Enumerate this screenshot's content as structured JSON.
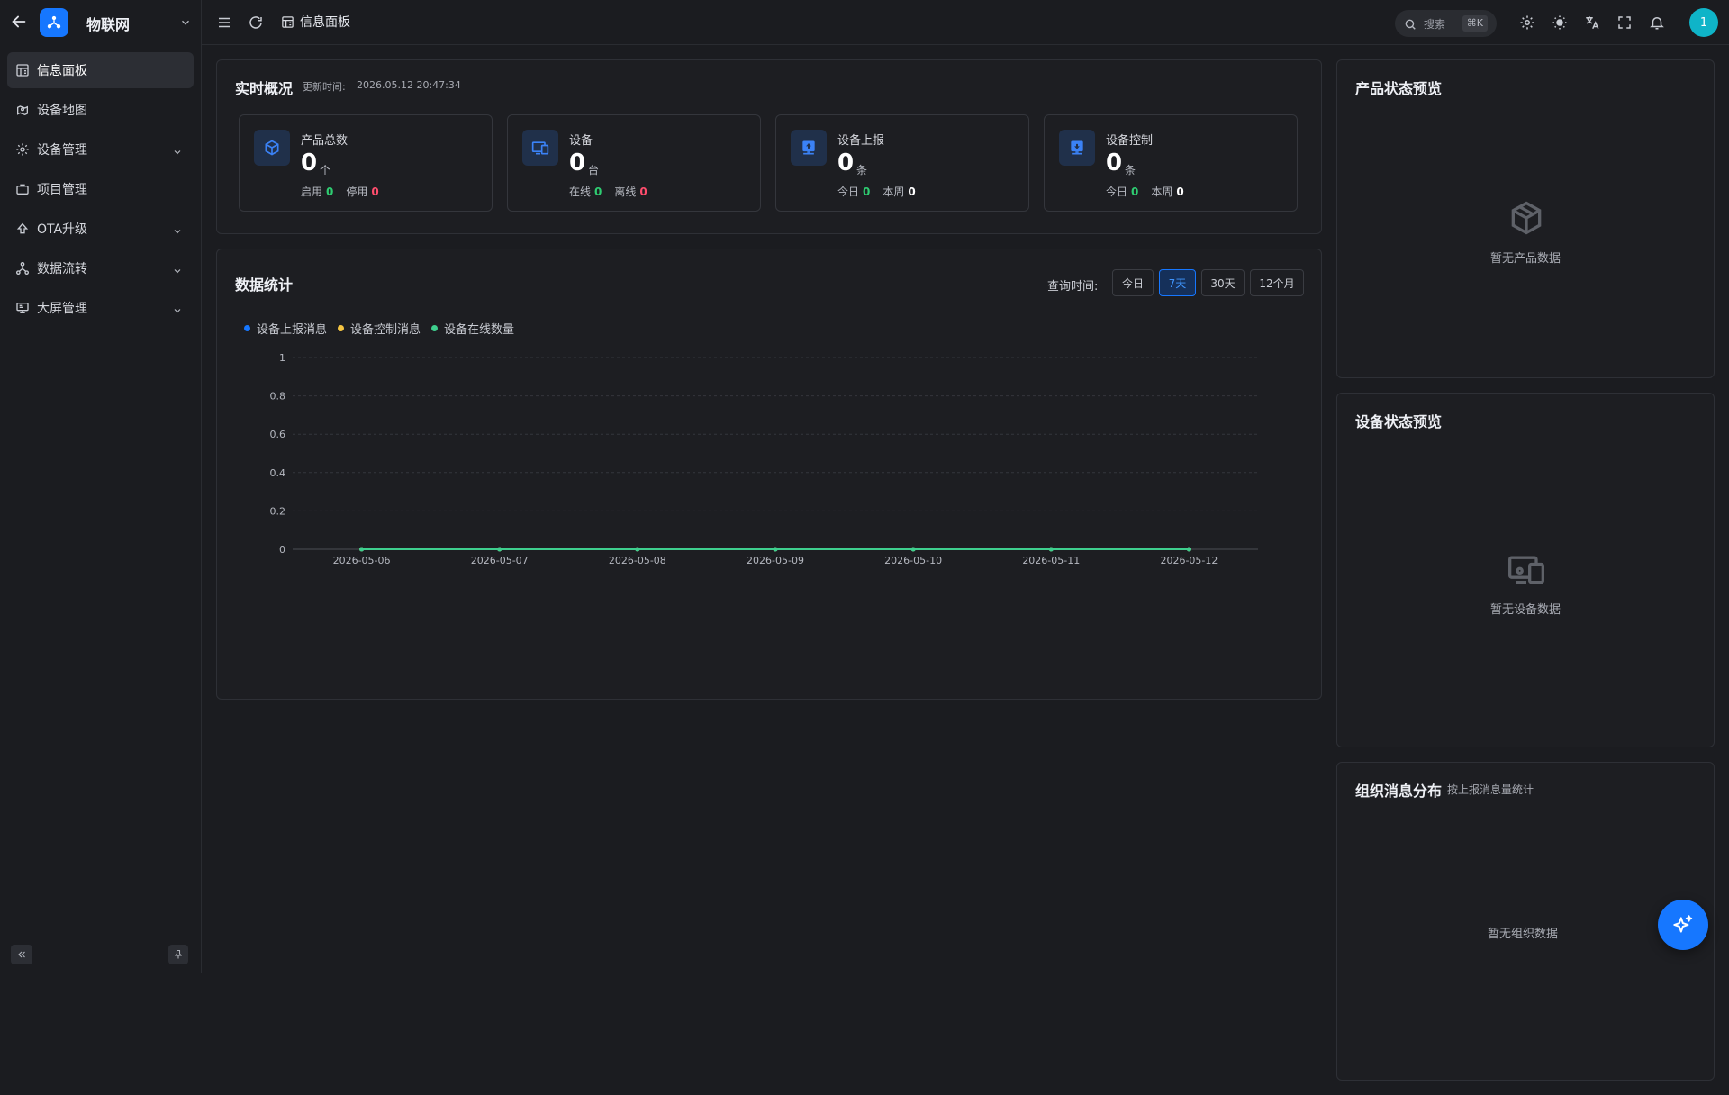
{
  "app": {
    "name": "物联网"
  },
  "header": {
    "breadcrumb": "信息面板",
    "search": {
      "placeholder": "搜索",
      "shortcut": "⌘K"
    },
    "avatar_text": "1"
  },
  "sidebar": {
    "items": [
      {
        "label": "信息面板",
        "icon": "dashboard-icon",
        "active": true,
        "expandable": false
      },
      {
        "label": "设备地图",
        "icon": "map-icon",
        "active": false,
        "expandable": false
      },
      {
        "label": "设备管理",
        "icon": "gear-icon",
        "active": false,
        "expandable": true
      },
      {
        "label": "项目管理",
        "icon": "briefcase-icon",
        "active": false,
        "expandable": false
      },
      {
        "label": "OTA升级",
        "icon": "upload-icon",
        "active": false,
        "expandable": true
      },
      {
        "label": "数据流转",
        "icon": "flow-icon",
        "active": false,
        "expandable": true
      },
      {
        "label": "大屏管理",
        "icon": "monitor-icon",
        "active": false,
        "expandable": true
      }
    ]
  },
  "overview": {
    "title": "实时概况",
    "updated_label": "更新时间:",
    "updated_time": "2026.05.12 20:47:34",
    "stats": [
      {
        "name": "产品总数",
        "value": "0",
        "unit": "个",
        "icon": "cube-icon",
        "sub": [
          {
            "label": "启用",
            "value": "0",
            "color": "green"
          },
          {
            "label": "停用",
            "value": "0",
            "color": "red"
          }
        ]
      },
      {
        "name": "设备",
        "value": "0",
        "unit": "台",
        "icon": "devices-icon",
        "sub": [
          {
            "label": "在线",
            "value": "0",
            "color": "green"
          },
          {
            "label": "离线",
            "value": "0",
            "color": "red"
          }
        ]
      },
      {
        "name": "设备上报",
        "value": "0",
        "unit": "条",
        "icon": "report-icon",
        "sub": [
          {
            "label": "今日",
            "value": "0",
            "color": "green"
          },
          {
            "label": "本周",
            "value": "0",
            "color": "white"
          }
        ]
      },
      {
        "name": "设备控制",
        "value": "0",
        "unit": "条",
        "icon": "control-icon",
        "sub": [
          {
            "label": "今日",
            "value": "0",
            "color": "green"
          },
          {
            "label": "本周",
            "value": "0",
            "color": "white"
          }
        ]
      }
    ]
  },
  "data_stats": {
    "title": "数据统计",
    "query_label": "查询时间:",
    "ranges": [
      {
        "label": "今日",
        "active": false
      },
      {
        "label": "7天",
        "active": true
      },
      {
        "label": "30天",
        "active": false
      },
      {
        "label": "12个月",
        "active": false
      }
    ],
    "chart_data": {
      "type": "line",
      "x": [
        "2026-05-06",
        "2026-05-07",
        "2026-05-08",
        "2026-05-09",
        "2026-05-10",
        "2026-05-11",
        "2026-05-12"
      ],
      "series": [
        {
          "name": "设备上报消息",
          "color": "#1677ff",
          "values": [
            0,
            0,
            0,
            0,
            0,
            0,
            0
          ]
        },
        {
          "name": "设备控制消息",
          "color": "#f5c542",
          "values": [
            0,
            0,
            0,
            0,
            0,
            0,
            0
          ]
        },
        {
          "name": "设备在线数量",
          "color": "#3ecf8e",
          "values": [
            0,
            0,
            0,
            0,
            0,
            0,
            0
          ]
        }
      ],
      "yticks": [
        "0",
        "0.2",
        "0.4",
        "0.6",
        "0.8",
        "1"
      ],
      "ylim": [
        0,
        1
      ],
      "grid": true,
      "legend": "top-left"
    }
  },
  "product_preview": {
    "title": "产品状态预览",
    "empty": "暂无产品数据"
  },
  "device_preview": {
    "title": "设备状态预览",
    "empty": "暂无设备数据"
  },
  "org_distribution": {
    "title": "组织消息分布",
    "subtitle": "按上报消息量统计",
    "empty": "暂无组织数据"
  },
  "colors": {
    "accent": "#1677ff",
    "online": "#2ecc71",
    "offline": "#ff4d6d",
    "avatar": "#0fb4c8"
  }
}
